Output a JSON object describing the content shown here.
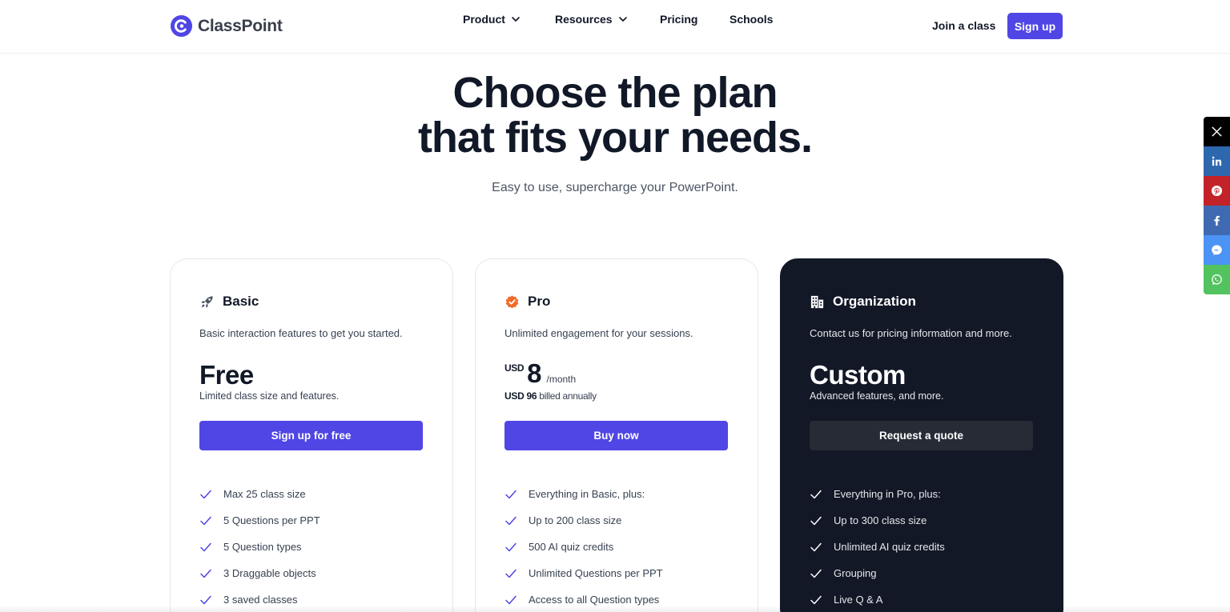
{
  "header": {
    "logo_text": "ClassPoint",
    "nav": [
      {
        "label": "Product",
        "has_dropdown": true
      },
      {
        "label": "Resources",
        "has_dropdown": true
      },
      {
        "label": "Pricing",
        "has_dropdown": false
      },
      {
        "label": "Schools",
        "has_dropdown": false
      }
    ],
    "join_label": "Join a class",
    "signup_label": "Sign up"
  },
  "hero": {
    "title_line1": "Choose the plan",
    "title_line2": "that fits your needs.",
    "subtitle": "Easy to use, supercharge your PowerPoint."
  },
  "social": [
    "x-icon",
    "linkedin-icon",
    "pinterest-icon",
    "facebook-icon",
    "messenger-icon",
    "whatsapp-icon"
  ],
  "plans": {
    "basic": {
      "name": "Basic",
      "icon": "rocket-icon",
      "description": "Basic interaction features to get you started.",
      "price": "Free",
      "price_note": "Limited class size and features.",
      "cta": "Sign up for free",
      "features": [
        "Max 25 class size",
        "5 Questions per PPT",
        "5 Question types",
        "3 Draggable objects",
        "3 saved classes"
      ]
    },
    "pro": {
      "name": "Pro",
      "icon": "verified-badge-icon",
      "description": "Unlimited engagement for your sessions.",
      "currency": "USD",
      "amount": "8",
      "period": "/month",
      "annual_price": "USD 96",
      "annual_text": " billed annually",
      "cta": "Buy now",
      "features": [
        "Everything in Basic, plus:",
        "Up to 200 class size",
        "500 AI quiz credits",
        "Unlimited Questions per PPT",
        "Access to all Question types"
      ]
    },
    "org": {
      "name": "Organization",
      "icon": "building-icon",
      "description": "Contact us for pricing information and more.",
      "price": "Custom",
      "price_note": "Advanced features, and more.",
      "cta": "Request a quote",
      "features": [
        "Everything in Pro, plus:",
        "Up to 300 class size",
        "Unlimited AI quiz credits",
        "Grouping",
        "Live Q & A"
      ]
    }
  },
  "colors": {
    "accent": "#4f46e5",
    "dark_card": "#121826",
    "text": "#111827",
    "pro_badge": "#f26b2a"
  }
}
